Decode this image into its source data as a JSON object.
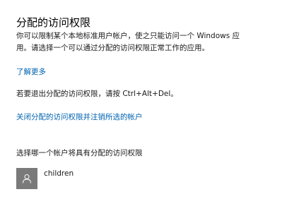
{
  "title": "分配的访问权限",
  "description": {
    "line1": "你可以限制某个本地标准用户帐户，使之只能访问一个 Windows 应",
    "line2": "用。请选择一个可以通过分配的访问权限正常工作的应用。"
  },
  "learn_more_link": "了解更多",
  "exit_hint": "若要退出分配的访问权限，请按 Ctrl+Alt+Del。",
  "close_link": "关闭分配的访问权限并注销所选的帐户",
  "choose_account_label": "选择哪一个帐户将具有分配的访问权限",
  "account": {
    "name": "children",
    "icon": "person-icon"
  },
  "colors": {
    "link": "#0063b1",
    "avatar_bg": "#7a7a7a"
  }
}
